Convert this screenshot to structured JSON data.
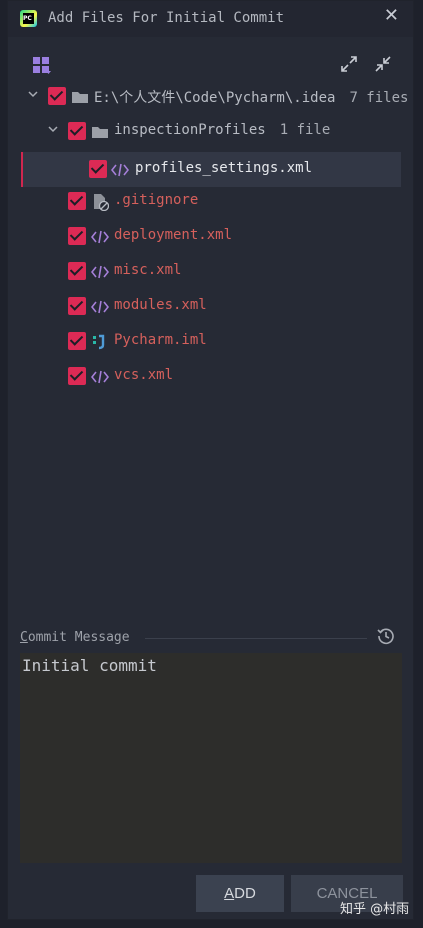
{
  "window": {
    "title": "Add Files For Initial Commit",
    "app_icon_text": "PC"
  },
  "tree": {
    "root": {
      "path": "E:\\个人文件\\Code\\Pycharm\\.idea",
      "count": "7 files"
    },
    "folder": {
      "name": "inspectionProfiles",
      "count": "1 file"
    },
    "selected_file": "profiles_settings.xml",
    "files": [
      ".gitignore",
      "deployment.xml",
      "misc.xml",
      "modules.xml",
      "Pycharm.iml",
      "vcs.xml"
    ]
  },
  "commit": {
    "label_first": "C",
    "label_rest": "ommit Message",
    "message": "Initial commit"
  },
  "buttons": {
    "add_first": "A",
    "add_rest": "DD",
    "cancel": "CANCEL"
  },
  "watermark": "知乎 @村雨",
  "colors": {
    "checkbox": "#dc2a55",
    "file_text": "#d5605c",
    "xml_icon": "#a57fd8",
    "background": "#262a35"
  }
}
